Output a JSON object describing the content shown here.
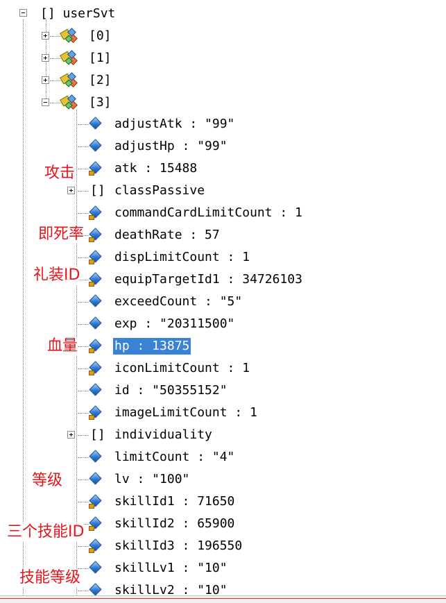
{
  "root": {
    "label": "[] userSvt",
    "toggle": "−"
  },
  "children": [
    {
      "label": "[0]",
      "toggle": "+"
    },
    {
      "label": "[1]",
      "toggle": "+"
    },
    {
      "label": "[2]",
      "toggle": "+"
    },
    {
      "label": "[3]",
      "toggle": "−"
    }
  ],
  "fields": [
    {
      "label": "adjustAtk : \"99\"",
      "type": "leaf"
    },
    {
      "label": "adjustHp : \"99\"",
      "type": "leaf"
    },
    {
      "label": "atk : 15488",
      "type": "leaf-num"
    },
    {
      "label": "classPassive",
      "type": "array",
      "toggle": "+"
    },
    {
      "label": "commandCardLimitCount : 1",
      "type": "leaf-num"
    },
    {
      "label": "deathRate : 57",
      "type": "leaf-num"
    },
    {
      "label": "dispLimitCount : 1",
      "type": "leaf-num"
    },
    {
      "label": "equipTargetId1 : 34726103",
      "type": "leaf-num"
    },
    {
      "label": "exceedCount : \"5\"",
      "type": "leaf"
    },
    {
      "label": "exp : \"20311500\"",
      "type": "leaf"
    },
    {
      "label": "hp : 13875",
      "type": "leaf-num",
      "selected": true
    },
    {
      "label": "iconLimitCount : 1",
      "type": "leaf-num"
    },
    {
      "label": "id : \"50355152\"",
      "type": "leaf"
    },
    {
      "label": "imageLimitCount : 1",
      "type": "leaf-num"
    },
    {
      "label": "individuality",
      "type": "array",
      "toggle": "+"
    },
    {
      "label": "limitCount : \"4\"",
      "type": "leaf"
    },
    {
      "label": "lv : \"100\"",
      "type": "leaf"
    },
    {
      "label": "skillId1 : 71650",
      "type": "leaf-num"
    },
    {
      "label": "skillId2 : 65900",
      "type": "leaf-num"
    },
    {
      "label": "skillId3 : 196550",
      "type": "leaf-num"
    },
    {
      "label": "skillLv1 : \"10\"",
      "type": "leaf"
    },
    {
      "label": "skillLv2 : \"10\"",
      "type": "leaf"
    }
  ],
  "array_marker": "[]",
  "annotations": [
    {
      "text": "攻击"
    },
    {
      "text": "即死率"
    },
    {
      "text": "礼装ID"
    },
    {
      "text": "血量"
    },
    {
      "text": "等级"
    },
    {
      "text": "三个技能ID"
    },
    {
      "text": "技能等级"
    }
  ],
  "colors": {
    "selection": "#3a82d6",
    "annotation": "#e8141c"
  }
}
